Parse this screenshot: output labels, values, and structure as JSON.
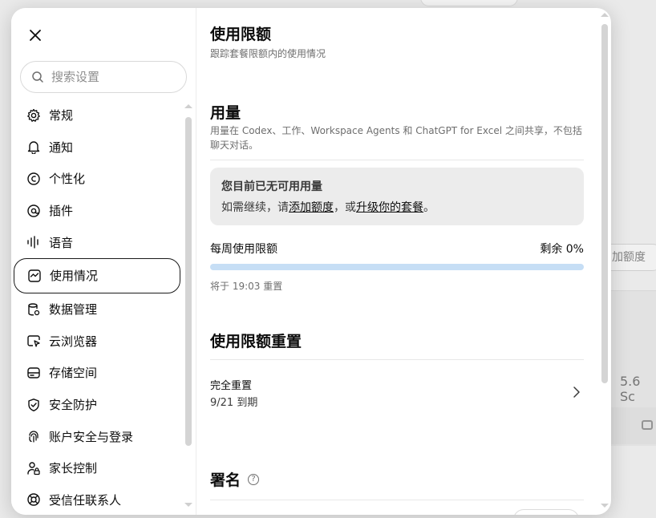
{
  "background": {
    "add_quota_label": "加额度",
    "number_label": "5.6 Sc"
  },
  "search": {
    "placeholder": "搜索设置"
  },
  "sidebar": {
    "items": [
      {
        "label": "常规",
        "icon": "gear-icon"
      },
      {
        "label": "通知",
        "icon": "bell-icon"
      },
      {
        "label": "个性化",
        "icon": "personalize-icon"
      },
      {
        "label": "插件",
        "icon": "plugin-icon"
      },
      {
        "label": "语音",
        "icon": "voice-icon"
      },
      {
        "label": "使用情况",
        "icon": "usage-icon",
        "active": true
      },
      {
        "label": "数据管理",
        "icon": "data-icon"
      },
      {
        "label": "云浏览器",
        "icon": "cloud-browser-icon"
      },
      {
        "label": "存储空间",
        "icon": "storage-icon"
      },
      {
        "label": "安全防护",
        "icon": "shield-icon"
      },
      {
        "label": "账户安全与登录",
        "icon": "account-security-icon"
      },
      {
        "label": "家长控制",
        "icon": "parental-control-icon"
      },
      {
        "label": "受信任联系人",
        "icon": "trusted-contact-icon"
      }
    ]
  },
  "main": {
    "title": "使用限额",
    "subtitle": "跟踪套餐限额内的使用情况",
    "usage": {
      "title": "用量",
      "description": "用量在 Codex、工作、Workspace Agents 和 ChatGPT for Excel 之间共享，不包括聊天对话。",
      "notice_title": "您目前已无可用用量",
      "notice_prefix": "如需继续，请",
      "notice_link1": "添加额度",
      "notice_mid": "，或",
      "notice_link2": "升级你的套餐",
      "notice_suffix": "。",
      "weekly_label": "每周使用限额",
      "remaining_label": "剩余 0%",
      "remaining_fraction": 0,
      "reset_note": "将于 19:03 重置"
    },
    "reset": {
      "title": "使用限额重置",
      "item_name": "完全重置",
      "item_date": "9/21 到期"
    },
    "signature": {
      "title": "署名",
      "help": "?"
    }
  },
  "colors": {
    "progress_track": "#c6def5",
    "notice_bg": "#ececec",
    "active_border": "#1a1a1a"
  }
}
